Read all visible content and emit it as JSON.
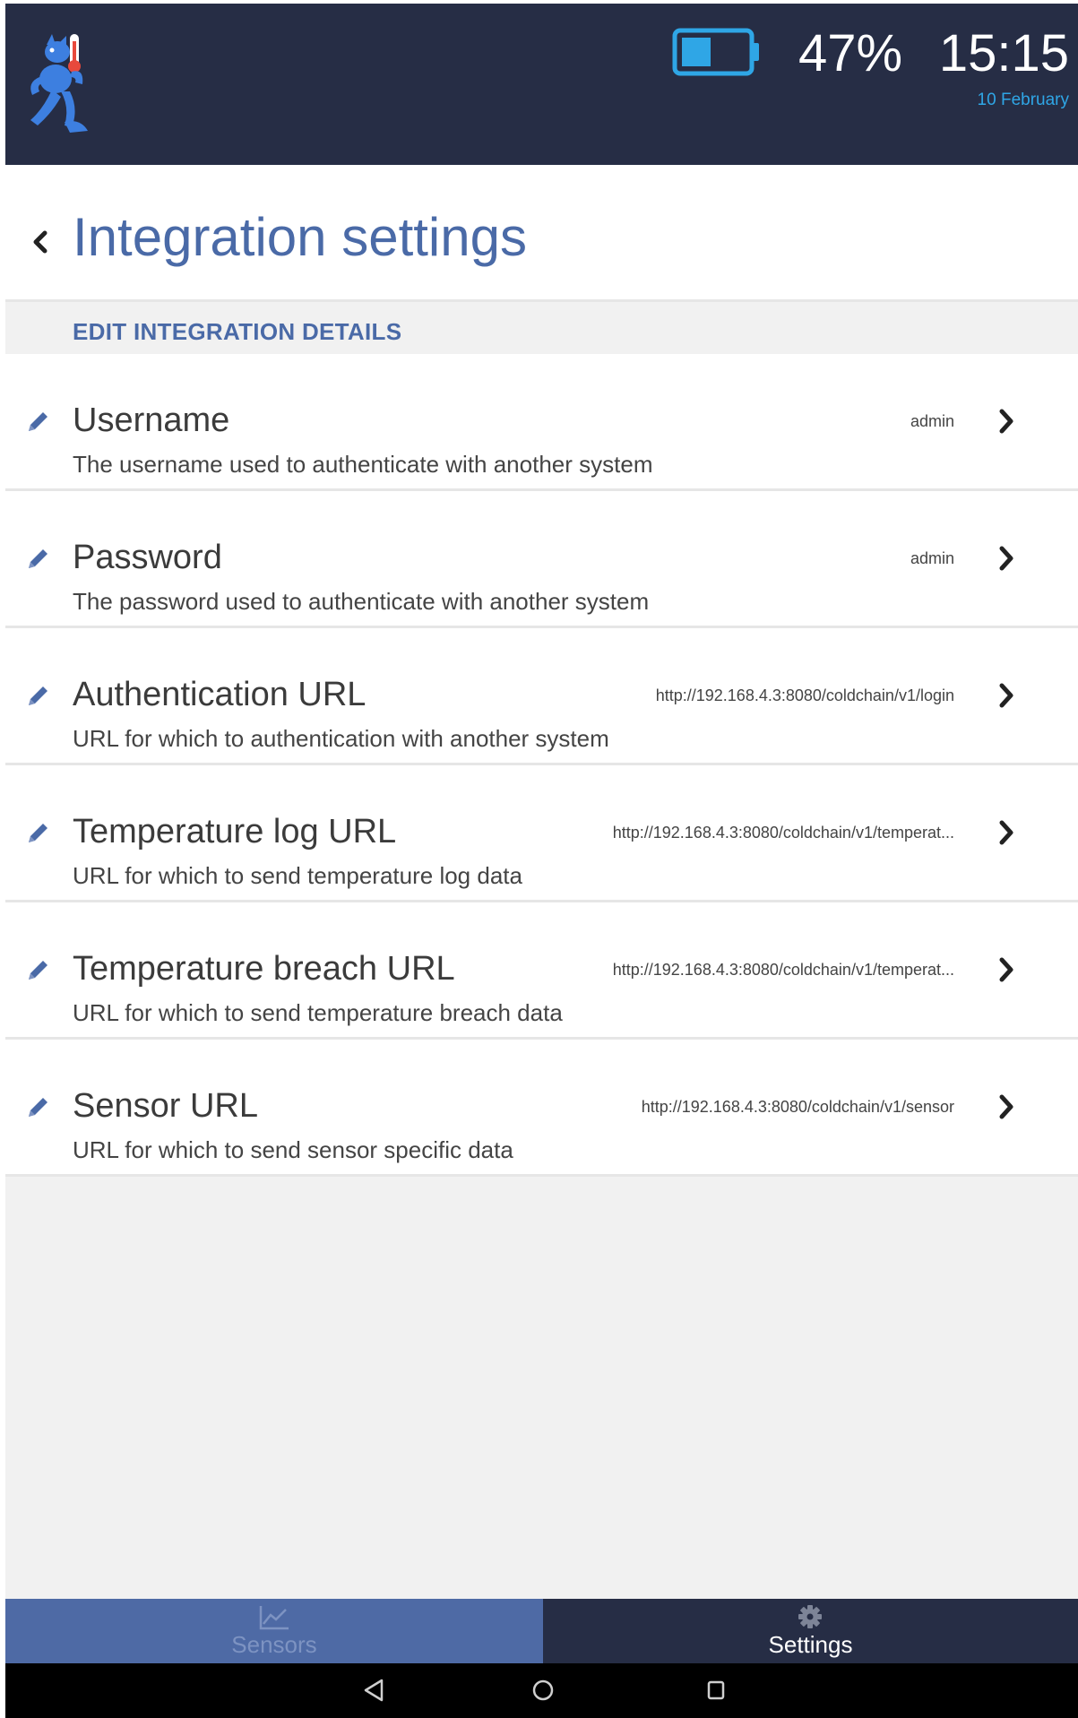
{
  "header": {
    "battery_percent": "47%",
    "battery_level": 0.47,
    "time": "15:15",
    "date": "10 February",
    "accent_color": "#2fa6e6",
    "logo_icon": "mascot-thermometer-logo-icon"
  },
  "page": {
    "back_icon": "chevron-left-icon",
    "title": "Integration settings",
    "section_label": "EDIT INTEGRATION DETAILS"
  },
  "settings": [
    {
      "title": "Username",
      "description": "The username used to authenticate with another system",
      "value": "admin"
    },
    {
      "title": "Password",
      "description": "The password used to authenticate with another system",
      "value": "admin"
    },
    {
      "title": "Authentication URL",
      "description": "URL for which to authentication with another system",
      "value": "http://192.168.4.3:8080/coldchain/v1/login"
    },
    {
      "title": "Temperature log URL",
      "description": "URL for which to send temperature log data",
      "value": "http://192.168.4.3:8080/coldchain/v1/temperat..."
    },
    {
      "title": "Temperature breach URL",
      "description": "URL for which to send temperature breach data",
      "value": "http://192.168.4.3:8080/coldchain/v1/temperat..."
    },
    {
      "title": "Sensor URL",
      "description": "URL for which to send sensor specific data",
      "value": "http://192.168.4.3:8080/coldchain/v1/sensor"
    }
  ],
  "bottom_nav": {
    "tabs": [
      {
        "label": "Sensors",
        "icon": "chart-icon",
        "active": false
      },
      {
        "label": "Settings",
        "icon": "gear-icon",
        "active": true
      }
    ]
  },
  "system_bar": {
    "buttons": [
      "back-triangle-icon",
      "home-circle-icon",
      "recents-square-icon"
    ]
  },
  "colors": {
    "header_bg": "#262d45",
    "title_blue": "#4a6aa7",
    "nav_active_tab_bg": "#4e6aa5"
  }
}
